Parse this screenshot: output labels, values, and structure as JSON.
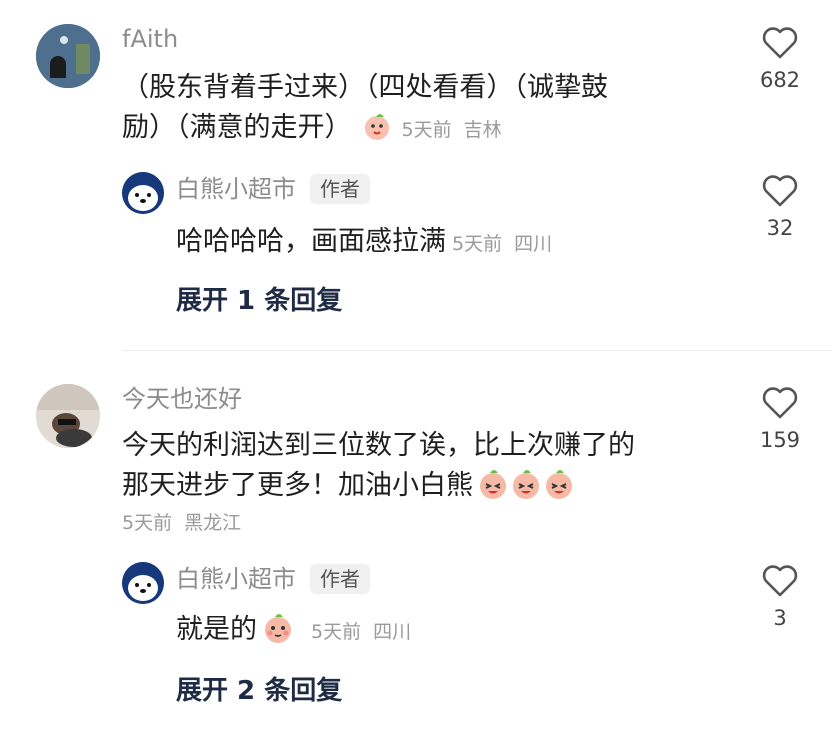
{
  "comments": [
    {
      "username": "fAith",
      "text_line1": "（股东背着手过来）（四处看看）（诚挚鼓",
      "text_line2": "励）（满意的走开）",
      "time": "5天前",
      "location": "吉林",
      "likes": "682",
      "emoji": "peach-face-emoji",
      "reply": {
        "username": "白熊小超市",
        "badge": "作者",
        "text": "哈哈哈哈，画面感拉满",
        "time": "5天前",
        "location": "四川",
        "likes": "32"
      },
      "expand_label": "展开 1 条回复"
    },
    {
      "username": "今天也还好",
      "text_line1": "今天的利润达到三位数了诶，比上次赚了的",
      "text_line2": "那天进步了更多！加油小白熊",
      "time": "5天前",
      "location": "黑龙江",
      "likes": "159",
      "emoji": "happy-peach-emoji",
      "reply": {
        "username": "白熊小超市",
        "badge": "作者",
        "text": "就是的",
        "time": "5天前",
        "location": "四川",
        "likes": "3",
        "emoji": "shy-peach-emoji"
      },
      "expand_label": "展开 2 条回复"
    }
  ],
  "colors": {
    "username": "#8c8c8c",
    "text": "#1f1f1f",
    "meta": "#9a9a9a",
    "expand": "#1f2a44",
    "emoji_peach": "#f6b3a3"
  }
}
